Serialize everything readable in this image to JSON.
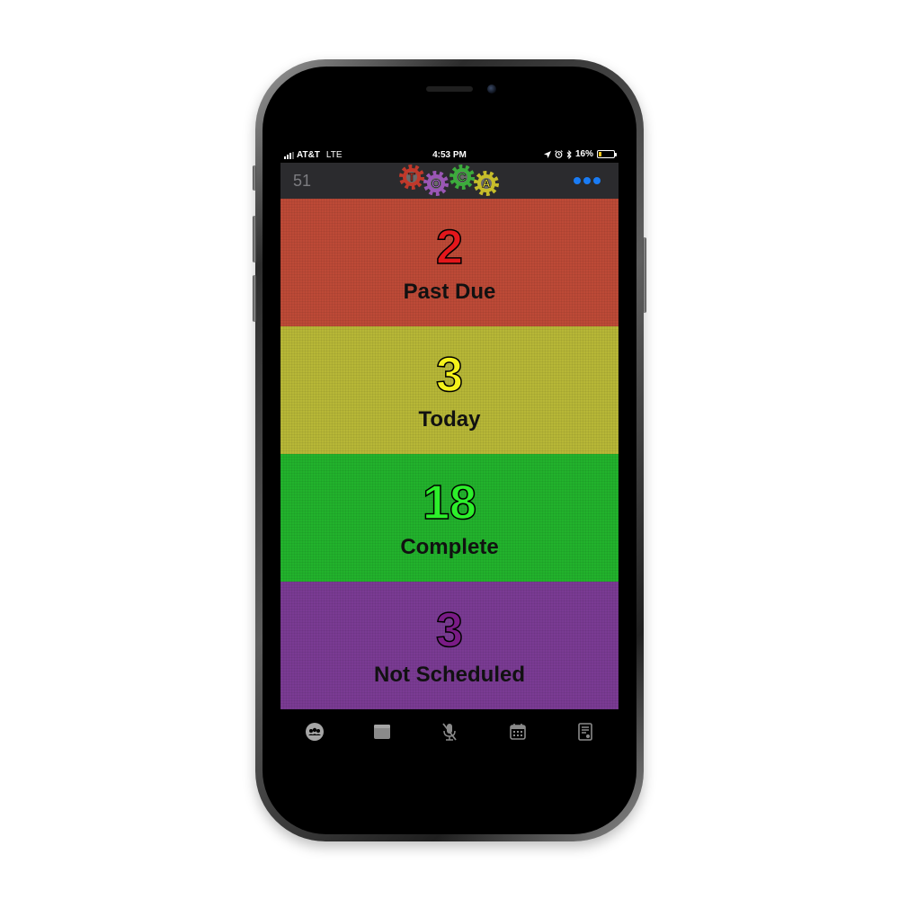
{
  "status_bar": {
    "carrier": "AT&T",
    "network": "LTE",
    "time": "4:53 PM",
    "battery_percent": "16%",
    "battery_level": 0.16
  },
  "nav": {
    "count": "51",
    "logo_letters": [
      "T",
      "O",
      "C",
      "A"
    ],
    "more_icon": "ellipsis-icon",
    "accent": "#1a7cf5"
  },
  "tiles": [
    {
      "value": "2",
      "label": "Past Due",
      "bg": "#bd4a37",
      "value_color": "#e4161b"
    },
    {
      "value": "3",
      "label": "Today",
      "bg": "#b7b737",
      "value_color": "#f5f21a"
    },
    {
      "value": "18",
      "label": "Complete",
      "bg": "#22b22c",
      "value_color": "#2cf02a"
    },
    {
      "value": "3",
      "label": "Not Scheduled",
      "bg": "#7a3b93",
      "value_color": "#7a1b86"
    }
  ],
  "tabs": [
    {
      "icon": "group-icon"
    },
    {
      "icon": "card-icon"
    },
    {
      "icon": "muted-microphone-icon"
    },
    {
      "icon": "calendar-icon"
    },
    {
      "icon": "document-icon"
    }
  ]
}
